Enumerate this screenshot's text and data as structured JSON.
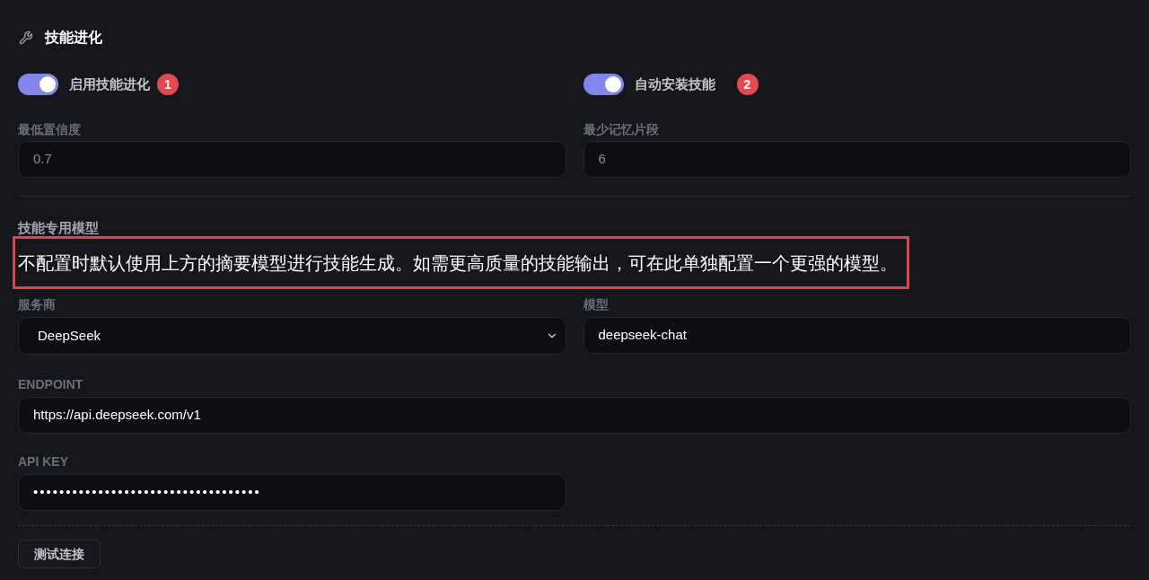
{
  "section": {
    "title": "技能进化"
  },
  "toggles": [
    {
      "label": "启用技能进化",
      "on": true,
      "badge": "1"
    },
    {
      "label": "自动安装技能",
      "on": true,
      "badge": "2"
    }
  ],
  "thresholds": [
    {
      "label": "最低置信度",
      "value": "0.7"
    },
    {
      "label": "最少记忆片段",
      "value": "6"
    }
  ],
  "model_section": {
    "title": "技能专用模型",
    "note": "不配置时默认使用上方的摘要模型进行技能生成。如需更高质量的技能输出，可在此单独配置一个更强的模型。",
    "note_highlighted": true
  },
  "model_fields": [
    {
      "kind": "select",
      "label": "服务商",
      "value": "DeepSeek"
    },
    {
      "kind": "text",
      "label": "模型",
      "value": "deepseek-chat"
    }
  ],
  "endpoint": {
    "label": "ENDPOINT",
    "value": "https://api.deepseek.com/v1"
  },
  "api_key": {
    "label": "API KEY",
    "value": "•••••••••••••••••••••••••••••••••••"
  },
  "buttons": [
    "测试连接"
  ]
}
